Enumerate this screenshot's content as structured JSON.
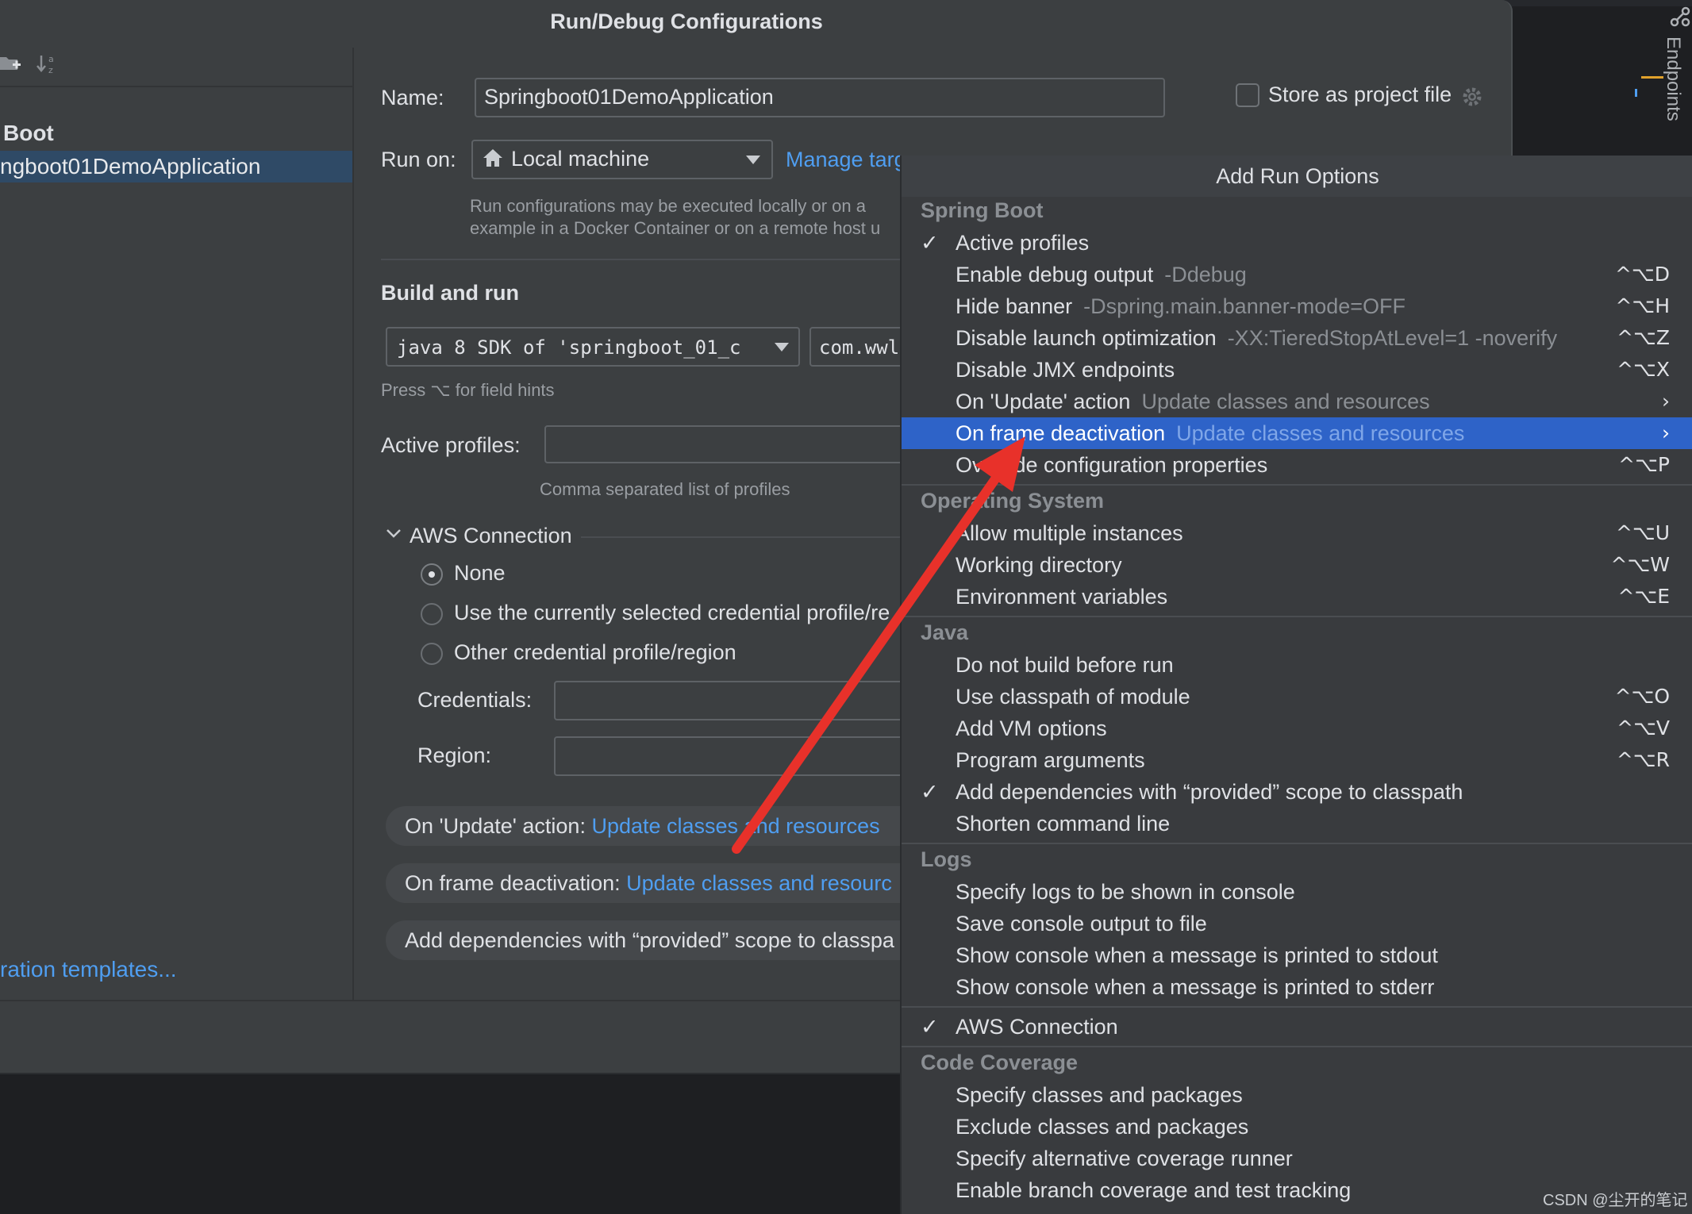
{
  "dialog": {
    "title": "Run/Debug Configurations",
    "tree": {
      "group": "Boot",
      "selected": "ngboot01DemoApplication"
    },
    "templates_link": "ration templates...",
    "name_label": "Name:",
    "name_value": "Springboot01DemoApplication",
    "store_label": "Store as project file",
    "run_on_label": "Run on:",
    "run_on_value": "Local machine",
    "manage_link": "Manage targ",
    "run_hint_1": "Run configurations may be executed locally or on a",
    "run_hint_2": "example in a Docker Container or on a remote host u",
    "build_title": "Build and run",
    "jdk_value": "java 8 SDK of 'springboot_01_c",
    "main_class_value": "com.wwl",
    "field_hint": "Press ⌥ for field hints",
    "active_profiles_label": "Active profiles:",
    "active_profiles_hint": "Comma separated list of profiles",
    "aws": {
      "title": "AWS Connection",
      "options": [
        "None",
        "Use the currently selected credential profile/re",
        "Other credential profile/region"
      ],
      "credentials_label": "Credentials:",
      "region_label": "Region:"
    },
    "pills": [
      {
        "label": "On 'Update' action: ",
        "value": "Update classes and resources"
      },
      {
        "label": "On frame deactivation: ",
        "value": "Update classes and resourc"
      },
      {
        "label": "Add dependencies with “provided” scope to classpa",
        "value": ""
      }
    ]
  },
  "endpoints_label": "Endpoints",
  "popup": {
    "title": "Add Run Options",
    "sections": {
      "spring_boot": "Spring Boot",
      "os": "Operating System",
      "java": "Java",
      "logs": "Logs",
      "coverage": "Code Coverage"
    },
    "items": {
      "active_profiles": {
        "label": "Active profiles",
        "sub": "",
        "sc": ""
      },
      "debug_output": {
        "label": "Enable debug output",
        "sub": "-Ddebug",
        "sc": "^⌥D"
      },
      "hide_banner": {
        "label": "Hide banner",
        "sub": "-Dspring.main.banner-mode=OFF",
        "sc": "^⌥H"
      },
      "disable_launch": {
        "label": "Disable launch optimization",
        "sub": "-XX:TieredStopAtLevel=1 -noverify",
        "sc": "^⌥Z"
      },
      "disable_jmx": {
        "label": "Disable JMX endpoints",
        "sub": "",
        "sc": "^⌥X"
      },
      "on_update": {
        "label": "On 'Update' action",
        "sub": "Update classes and resources",
        "sc": "›"
      },
      "on_frame": {
        "label": "On frame deactivation",
        "sub": "Update classes and resources",
        "sc": "›"
      },
      "override_props": {
        "label": "Override configuration properties",
        "sub": "",
        "sc": "^⌥P"
      },
      "multi_instances": {
        "label": "Allow multiple instances",
        "sub": "",
        "sc": "^⌥U"
      },
      "working_dir": {
        "label": "Working directory",
        "sub": "",
        "sc": "^⌥W"
      },
      "env_vars": {
        "label": "Environment variables",
        "sub": "",
        "sc": "^⌥E"
      },
      "no_build": {
        "label": "Do not build before run",
        "sub": "",
        "sc": ""
      },
      "classpath_module": {
        "label": "Use classpath of module",
        "sub": "",
        "sc": "^⌥O"
      },
      "vm_options": {
        "label": "Add VM options",
        "sub": "",
        "sc": "^⌥V"
      },
      "program_args": {
        "label": "Program arguments",
        "sub": "",
        "sc": "^⌥R"
      },
      "provided_scope": {
        "label": "Add dependencies with “provided” scope to classpath",
        "sub": "",
        "sc": ""
      },
      "shorten_cmd": {
        "label": "Shorten command line",
        "sub": "",
        "sc": ""
      },
      "logs_console": {
        "label": "Specify logs to be shown in console",
        "sub": "",
        "sc": ""
      },
      "save_console": {
        "label": "Save console output to file",
        "sub": "",
        "sc": ""
      },
      "stdout": {
        "label": "Show console when a message is printed to stdout",
        "sub": "",
        "sc": ""
      },
      "stderr": {
        "label": "Show console when a message is printed to stderr",
        "sub": "",
        "sc": ""
      },
      "aws_connection": {
        "label": "AWS Connection",
        "sub": "",
        "sc": ""
      },
      "specify_classes": {
        "label": "Specify classes and packages",
        "sub": "",
        "sc": ""
      },
      "exclude_classes": {
        "label": "Exclude classes and packages",
        "sub": "",
        "sc": ""
      },
      "alt_runner": {
        "label": "Specify alternative coverage runner",
        "sub": "",
        "sc": ""
      },
      "branch_coverage": {
        "label": "Enable branch coverage and test tracking",
        "sub": "",
        "sc": ""
      }
    },
    "checkmark": "✓"
  },
  "watermark": "CSDN @尘开的笔记",
  "colors": {
    "dialog_bg": "#3c3f41",
    "popup_bg": "#393b3e",
    "selection": "#2e63c8",
    "link": "#4f9ef1",
    "arrow": "#e8312a"
  }
}
